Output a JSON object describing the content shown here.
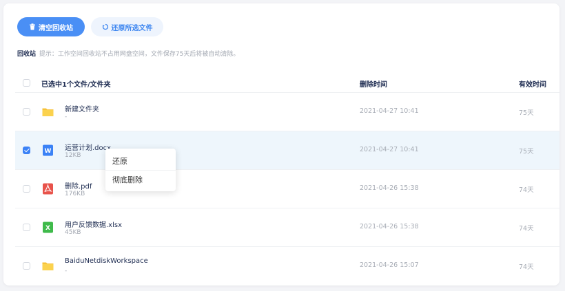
{
  "toolbar": {
    "empty_label": "清空回收站",
    "restore_label": "还原所选文件"
  },
  "hint": {
    "title": "回收站",
    "text": "提示：工作空间回收站不占用网盘空间，文件保存75天后将被自动清除。"
  },
  "table": {
    "header": {
      "selection_label": "已选中1个文件/文件夹",
      "deleted_time": "删除时间",
      "valid_time": "有效时间"
    },
    "rows": [
      {
        "name": "新建文件夹",
        "size": "-",
        "deleted": "2021-04-27 10:41",
        "valid": "75天",
        "type": "folder",
        "checked": false
      },
      {
        "name": "运营计划.docx",
        "size": "12KB",
        "deleted": "2021-04-27 10:41",
        "valid": "75天",
        "type": "word",
        "checked": true
      },
      {
        "name": "删除.pdf",
        "size": "176KB",
        "deleted": "2021-04-26 15:38",
        "valid": "74天",
        "type": "pdf",
        "checked": false
      },
      {
        "name": "用户反馈数据.xlsx",
        "size": "45KB",
        "deleted": "2021-04-26 15:38",
        "valid": "74天",
        "type": "excel",
        "checked": false
      },
      {
        "name": "BaiduNetdiskWorkspace",
        "size": "-",
        "deleted": "2021-04-26 15:07",
        "valid": "74天",
        "type": "folder",
        "checked": false
      }
    ]
  },
  "context_menu": {
    "restore": "还原",
    "delete_forever": "彻底删除"
  },
  "colors": {
    "primary": "#4a8ff5",
    "selected_row": "#eef6fc",
    "folder": "#f7c23a",
    "word": "#3b82f6",
    "pdf": "#e8534b",
    "excel": "#3fba4b"
  }
}
